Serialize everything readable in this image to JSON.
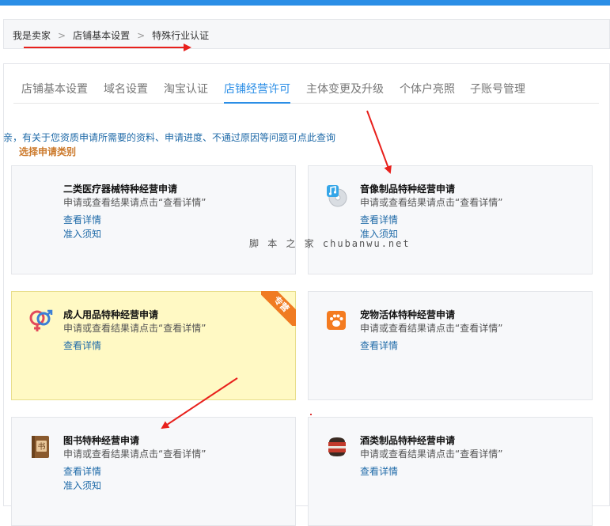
{
  "breadcrumb": {
    "items": [
      "我是卖家",
      "店铺基本设置",
      "特殊行业认证"
    ],
    "separator": ">"
  },
  "tabs": [
    {
      "label": "店铺基本设置"
    },
    {
      "label": "域名设置"
    },
    {
      "label": "淘宝认证"
    },
    {
      "label": "店铺经营许可"
    },
    {
      "label": "主体变更及升级"
    },
    {
      "label": "个体户亮照"
    },
    {
      "label": "子账号管理"
    }
  ],
  "active_tab": "店铺经营许可",
  "notice": "亲，有关于您资质申请所需要的资料、申请进度、不通过原因等问题可点此查询",
  "section_title": "选择申请类别",
  "cards": [
    {
      "title": "二类医疗器械特种经营申请",
      "desc": "申请或查看结果请点击“查看详情”",
      "link1": "查看详情",
      "link2": "准入须知",
      "icon": "none"
    },
    {
      "title": "音像制品特种经营申请",
      "desc": "申请或查看结果请点击“查看详情”",
      "link1": "查看详情",
      "link2": "准入须知",
      "icon": "music-disc-icon"
    },
    {
      "title": "成人用品特种经营申请",
      "desc": "申请或查看结果请点击“查看详情”",
      "link1": "查看详情",
      "link2": "",
      "icon": "gender-symbols-icon",
      "ribbon": "专营"
    },
    {
      "title": "宠物活体特种经营申请",
      "desc": "申请或查看结果请点击“查看详情”",
      "link1": "查看详情",
      "link2": "",
      "icon": "paw-icon"
    },
    {
      "title": "图书特种经营申请",
      "desc": "申请或查看结果请点击“查看详情”",
      "link1": "查看详情",
      "link2": "准入须知",
      "icon": "book-icon",
      "icon_text": "书"
    },
    {
      "title": "酒类制品特种经营申请",
      "desc": "申请或查看结果请点击“查看详情”",
      "link1": "查看详情",
      "link2": "",
      "icon": "wine-barrel-icon"
    }
  ],
  "watermark": "脚  本  之  家  chubanwu.net",
  "colors": {
    "accent": "#2b8ee6",
    "link": "#1f6aa8",
    "section_title": "#cc7a2c",
    "ribbon": "#f07b22",
    "highlight_card": "#fff9c4",
    "arrow": "#e8201c"
  }
}
